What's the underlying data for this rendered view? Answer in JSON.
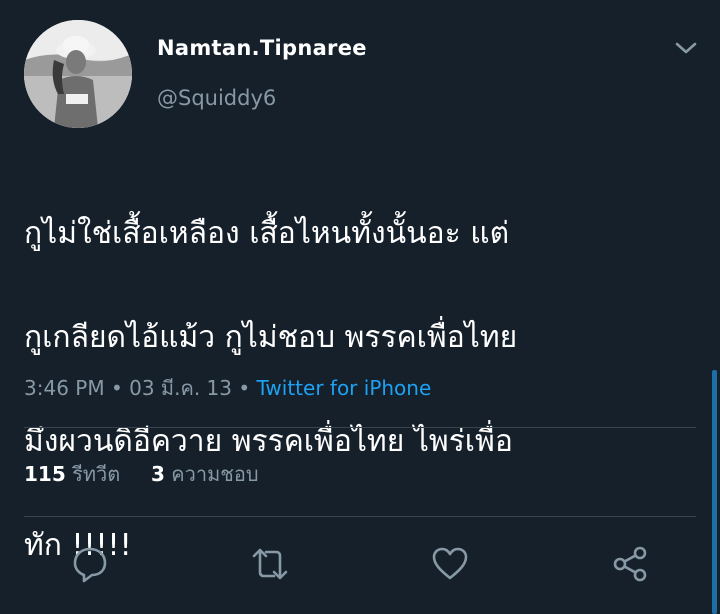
{
  "tweet": {
    "display_name": "Namtan.Tipnaree",
    "handle": "@Squiddy6",
    "lines": [
      "กูไม่ใช่เสื้อเหลือง เสื้อไหนทั้งนั้นอะ แต่",
      "กูเกลียดไอ้แม้ว กูไม่ชอบ พรรคเพื่อไทย",
      "มึงผวนดิอีควาย พรรคเพื่อไทย ไพร่เพื่อ",
      "ทัก !!!!!"
    ],
    "time": "3:46 PM",
    "separator": "•",
    "date": "03 มี.ค. 13",
    "source": "Twitter for iPhone"
  },
  "stats": {
    "retweets_count": "115",
    "retweets_label": "รีทวีต",
    "likes_count": "3",
    "likes_label": "ความชอบ"
  },
  "icons": {
    "reply": "reply-icon",
    "retweet": "retweet-icon",
    "like": "heart-icon",
    "share": "share-icon",
    "menu": "chevron-down-icon"
  },
  "colors": {
    "background": "#15202b",
    "secondary_text": "#8899a6",
    "link": "#1da1f2",
    "divider": "#38444d"
  }
}
